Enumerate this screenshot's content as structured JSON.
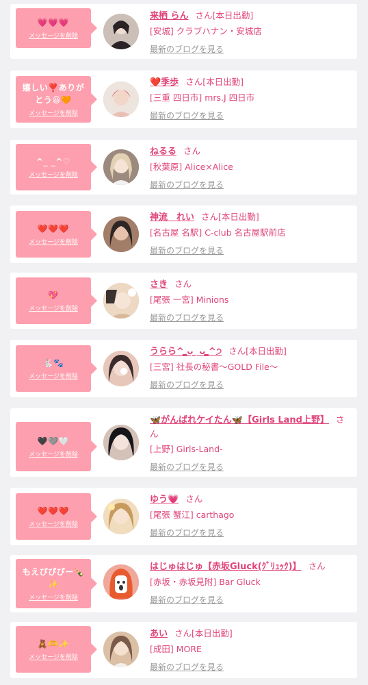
{
  "delete_label": "メッセージを削除",
  "blog_label": "最新のブログを見る",
  "honorific": "さん",
  "items": [
    {
      "msg": "💗💗💗",
      "name": "来栖 らん",
      "status": "[本日出勤]",
      "shop": "[安城] クラブハナン・安城店",
      "avatar_colors": [
        "#2a2326",
        "#cbbfb7"
      ]
    },
    {
      "msg": "嬉しい❣️ありがとう😆🧡",
      "name": "❤️季歩",
      "status": "[本日出勤]",
      "shop": "[三重 四日市] mrs.J 四日市",
      "avatar_colors": [
        "#d36f75",
        "#f2d6c8"
      ]
    },
    {
      "msg": "^_ _^♡",
      "name": "ねるる",
      "status": "",
      "shop": "[秋葉原] Alice×Alice",
      "avatar_colors": [
        "#e2d2b3",
        "#9b8a7d"
      ]
    },
    {
      "msg": "❤️❤️❤️",
      "name": "神流　れい",
      "status": "[本日出勤]",
      "shop": "[名古屋 名駅] C-club 名古屋駅前店",
      "avatar_colors": [
        "#2e2625",
        "#a27d67"
      ]
    },
    {
      "msg": "💖",
      "name": "さき",
      "status": "",
      "shop": "[尾張 一宮] Minions",
      "avatar_colors": [
        "#ecd8c3",
        "#3b3230"
      ]
    },
    {
      "msg": "🐇🐾",
      "name": "うらら^ ̳ᴗ ̫ ᴗ ̳^੭",
      "status": "[本日出勤]",
      "shop": "[三宮] 社長の秘書〜GOLD File〜",
      "avatar_colors": [
        "#3a2c2c",
        "#e8c7bb"
      ]
    },
    {
      "msg": "🖤🩶🤍",
      "name": "🦋がんばれケイたん🦋【Girls Land上野】",
      "status": "",
      "shop": "[上野] Girls-Land-",
      "avatar_colors": [
        "#15151a",
        "#d4c1b8"
      ]
    },
    {
      "msg": "❤️❤️❤️",
      "name": "ゆう💗",
      "status": "",
      "shop": "[尾張 蟹江] carthago",
      "avatar_colors": [
        "#c79b5d",
        "#f1ddbe"
      ]
    },
    {
      "msg": "もえぴぴぴー🍾✨",
      "name": "はじゅはじゅ【赤坂Gluck(ｸﾞﾘｭｯｸ)】",
      "status": "",
      "shop": "[赤坂・赤坂見附] Bar Gluck",
      "avatar_colors": [
        "#f0a89a",
        "#e85b2f"
      ]
    },
    {
      "msg": "🧸🫶✨",
      "name": "あい",
      "status": "[本日出勤]",
      "shop": "[成田] MORE",
      "avatar_colors": [
        "#dbc0a6",
        "#7a5a48"
      ]
    }
  ]
}
